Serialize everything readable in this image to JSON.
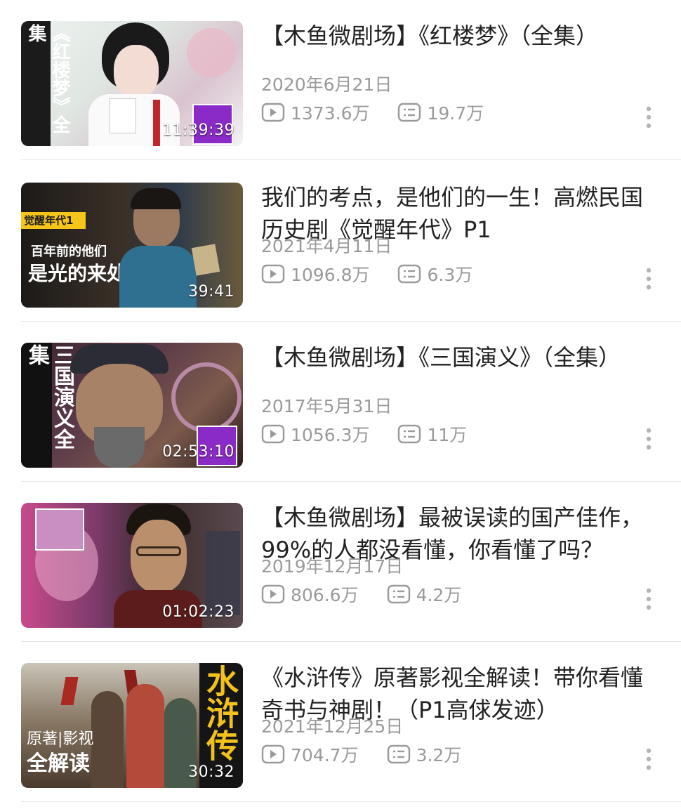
{
  "videos": [
    {
      "title": "【木鱼微剧场】《红楼梦》（全集）",
      "date": "2020年6月21日",
      "views": "1373.6万",
      "comments": "19.7万",
      "duration": "11:39:39"
    },
    {
      "title": "我们的考点，是他们的一生！高燃民国历史剧《觉醒年代》P1",
      "date": "2021年4月11日",
      "views": "1096.8万",
      "comments": "6.3万",
      "duration": "39:41"
    },
    {
      "title": "【木鱼微剧场】《三国演义》（全集）",
      "date": "2017年5月31日",
      "views": "1056.3万",
      "comments": "11万",
      "duration": "02:53:10"
    },
    {
      "title": "【木鱼微剧场】最被误读的国产佳作，99%的人都没看懂，你看懂了吗？",
      "date": "2019年12月17日",
      "views": "806.6万",
      "comments": "4.2万",
      "duration": "01:02:23"
    },
    {
      "title": "《水浒传》原著影视全解读！带你看懂奇书与神剧！（P1高俅发迹）",
      "date": "2021年12月25日",
      "views": "704.7万",
      "comments": "3.2万",
      "duration": "30:32"
    }
  ],
  "icons": {
    "views": "play-count-icon",
    "comments": "danmaku-count-icon",
    "more": "more-vertical-icon"
  },
  "colors": {
    "title": "#222222",
    "meta": "#9a9a9a",
    "divider": "#e8e8e8",
    "badge": "#8b2bc7"
  },
  "thumb_text": {
    "v1_side": "《红楼梦》全集",
    "v2_tag": "觉醒年代1",
    "v2_line1": "百年前的他们",
    "v2_line2": "是光的来处",
    "v3_side": "三国演义全集",
    "v5_side": "水浒传",
    "v5_caption1": "原著|影视",
    "v5_caption2": "全解读"
  }
}
